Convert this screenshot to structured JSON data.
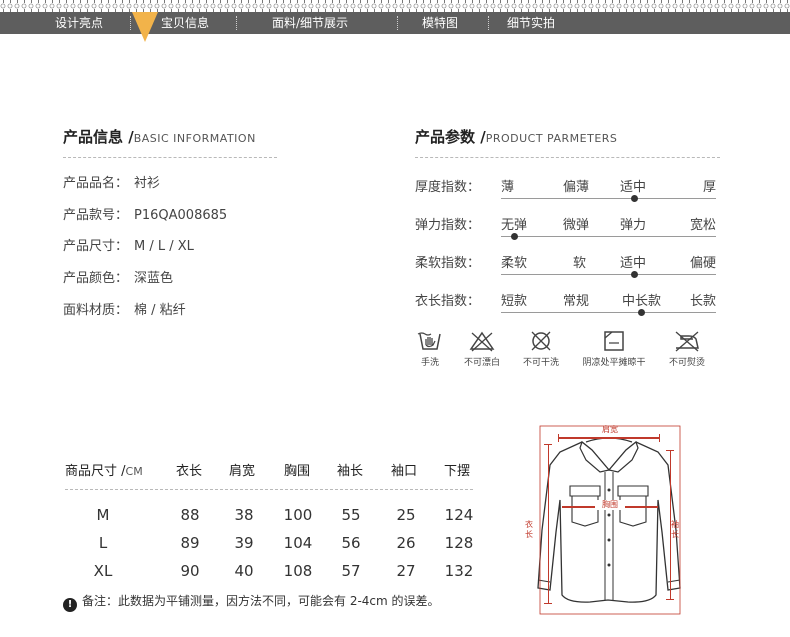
{
  "nav": {
    "items": [
      "设计亮点",
      "宝贝信息",
      "面料/细节展示",
      "模特图",
      "细节实拍"
    ],
    "active_index": 1,
    "accent_color": "#f2b34a"
  },
  "basic_info": {
    "title": "产品信息 /",
    "subtitle": "BASIC INFORMATION",
    "rows": [
      {
        "label": "产品品名：",
        "value": "衬衫"
      },
      {
        "label": "产品款号：",
        "value": "P16QA008685"
      },
      {
        "label": "产品尺寸：",
        "value": "M / L / XL"
      },
      {
        "label": "产品颜色：",
        "value": "深蓝色"
      },
      {
        "label": "面料材质：",
        "value": "棉 / 粘纤"
      }
    ]
  },
  "params": {
    "title": "产品参数 /",
    "subtitle": "PRODUCT PARMETERS",
    "rows": [
      {
        "label": "厚度指数：",
        "options": [
          "薄",
          "偏薄",
          "适中",
          "厚"
        ],
        "selected_index": 2
      },
      {
        "label": "弹力指数：",
        "options": [
          "无弹",
          "微弹",
          "弹力",
          "宽松"
        ],
        "selected_index": 0
      },
      {
        "label": "柔软指数：",
        "options": [
          "柔软",
          "软",
          "适中",
          "偏硬"
        ],
        "selected_index": 2
      },
      {
        "label": "衣长指数：",
        "options": [
          "短款",
          "常规",
          "中长款",
          "长款"
        ],
        "selected_index": 2
      }
    ]
  },
  "care": [
    {
      "icon": "hand-wash-icon",
      "label": "手洗"
    },
    {
      "icon": "no-bleach-icon",
      "label": "不可漂白"
    },
    {
      "icon": "no-dry-clean-icon",
      "label": "不可干洗"
    },
    {
      "icon": "dry-flat-shade-icon",
      "label": "阴凉处平摊晾干"
    },
    {
      "icon": "no-iron-icon",
      "label": "不可熨烫"
    }
  ],
  "size_table": {
    "title": "商品尺寸 /",
    "unit": "CM",
    "columns": [
      "衣长",
      "肩宽",
      "胸围",
      "袖长",
      "袖口",
      "下摆"
    ],
    "rows": [
      {
        "size": "M",
        "values": [
          "88",
          "38",
          "100",
          "55",
          "25",
          "124"
        ]
      },
      {
        "size": "L",
        "values": [
          "89",
          "39",
          "104",
          "56",
          "26",
          "128"
        ]
      },
      {
        "size": "XL",
        "values": [
          "90",
          "40",
          "108",
          "57",
          "27",
          "132"
        ]
      }
    ],
    "note": "备注：此数据为平铺测量，因方法不同，可能会有 2-4cm 的误差。",
    "note_icon": "!"
  },
  "diagram": {
    "shoulder_label": "肩宽",
    "chest_label": "胸围",
    "length_label": "衣长",
    "sleeve_label": "袖长",
    "measure_color": "#c0392b"
  }
}
